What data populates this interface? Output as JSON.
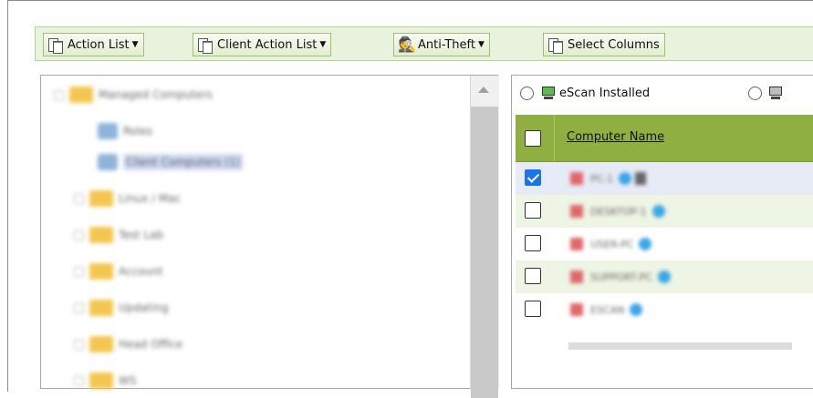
{
  "toolbar": {
    "action_list": "Action List",
    "client_action_list": "Client Action List",
    "anti_theft": "Anti-Theft",
    "select_columns": "Select Columns"
  },
  "tree": {
    "items": [
      {
        "label": "Managed Computers",
        "type": "folder",
        "blurred": true
      },
      {
        "label": "Roles",
        "type": "leaf",
        "blurred": true
      },
      {
        "label": "Client Computers (1)",
        "type": "leaf",
        "selected": true,
        "blurred": true
      },
      {
        "label": "Linux / Mac",
        "type": "folder",
        "blurred": true
      },
      {
        "label": "Test Lab",
        "type": "folder",
        "blurred": true
      },
      {
        "label": "Account",
        "type": "folder",
        "blurred": true
      },
      {
        "label": "Updating",
        "type": "folder",
        "blurred": true
      },
      {
        "label": "Head Office",
        "type": "folder",
        "blurred": true
      },
      {
        "label": "WS",
        "type": "folder",
        "blurred": true
      }
    ]
  },
  "grid": {
    "filter_escan_installed": "eScan Installed",
    "column_computer_name": "Computer Name",
    "rows": [
      {
        "checked": true,
        "name": "PC-1"
      },
      {
        "checked": false,
        "name": "DESKTOP-1"
      },
      {
        "checked": false,
        "name": "USER-PC"
      },
      {
        "checked": false,
        "name": "SUPPORT-PC"
      },
      {
        "checked": false,
        "name": "ESCAN"
      }
    ]
  },
  "colors": {
    "toolbar_bg": "#e9f2dc",
    "grid_header_bg": "#8fb040",
    "row_alt_bg": "#eef5e4",
    "row_selected_bg": "#e7ebf6",
    "checkbox_checked": "#1a73e8"
  }
}
